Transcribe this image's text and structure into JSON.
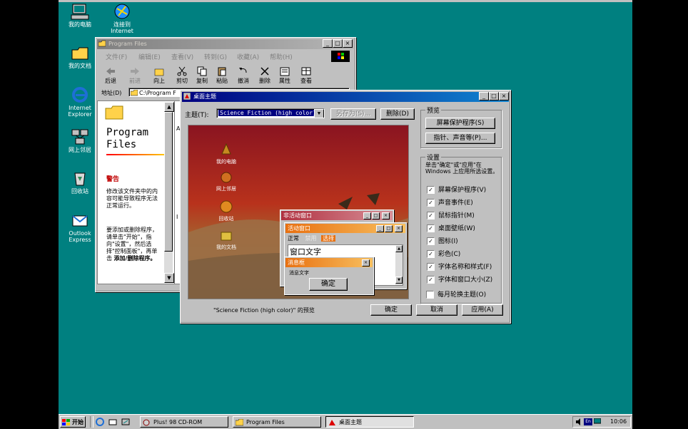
{
  "desktop_icons": [
    {
      "label": "我的电脑"
    },
    {
      "label": "连接到\nInternet"
    },
    {
      "label": "我的文档"
    },
    {
      "label": "Internet\nExplorer"
    },
    {
      "label": "网上邻居"
    },
    {
      "label": "回收站"
    },
    {
      "label": "Outlook\nExpress"
    }
  ],
  "explorer": {
    "title": "Program Files",
    "menu": [
      "文件(F)",
      "编辑(E)",
      "查看(V)",
      "转到(G)",
      "收藏(A)",
      "帮助(H)"
    ],
    "toolbar": [
      "后退",
      "前进",
      "向上",
      "剪切",
      "复制",
      "粘贴",
      "撤消",
      "删除",
      "属性",
      "查看"
    ],
    "address_label": "地址(D)",
    "address_value": "C:\\Program F",
    "folder_title": "Program\nFiles",
    "warning_heading": "警告",
    "warning_text": "修改该文件夹中的内容可能导致程序无法正常运行。",
    "hint_text": "要添加或删除程序，请单击\"开始\"，指向\"设置\"，然后选择\"控制面板\"，再单击",
    "hint_bold": "添加/删除程序。",
    "side_letters": [
      "A",
      "I"
    ]
  },
  "themes": {
    "title": "桌面主题",
    "theme_label": "主题(T):",
    "theme_value": "Science Fiction (high color)",
    "save_as": "另存为(S)...",
    "delete": "删除(D)",
    "preview_group": "预览",
    "screensaver_btn": "屏幕保护程序(S)",
    "pointers_btn": "指针、声音等(P)...",
    "settings_group": "设置",
    "settings_desc": "单击\"确定\"或\"应用\"在 Windows 上应用所选设置。",
    "settings": [
      "屏幕保护程序(V)",
      "声音事件(E)",
      "鼠标指针(M)",
      "桌面壁纸(W)",
      "图标(I)",
      "彩色(C)",
      "字体名称和样式(F)",
      "字体和窗口大小(Z)"
    ],
    "monthly": "每月轮换主题(O)",
    "preview_caption": "\"Science Fiction (high color)\" 的预览",
    "ok": "确定",
    "cancel": "取消",
    "apply": "应用(A)",
    "preview_icons": [
      "我的电脑",
      "网上邻居",
      "回收站",
      "我的文档"
    ],
    "inactive_title": "非活动窗口",
    "active_title": "活动窗口",
    "menu_items": [
      "正常",
      "禁用",
      "选择"
    ],
    "window_text": "窗口文字",
    "msg_title": "消息框",
    "msg_text": "消息文字",
    "msg_ok": "确定"
  },
  "taskbar": {
    "start": "开始",
    "tasks": [
      "Plus! 98 CD-ROM",
      "Program Files",
      "桌面主题"
    ],
    "clock": "10:06",
    "tray": "En"
  },
  "colors": {
    "desktop": "#008080",
    "titlebar": "#000080",
    "preview_bg": "#a02020"
  }
}
